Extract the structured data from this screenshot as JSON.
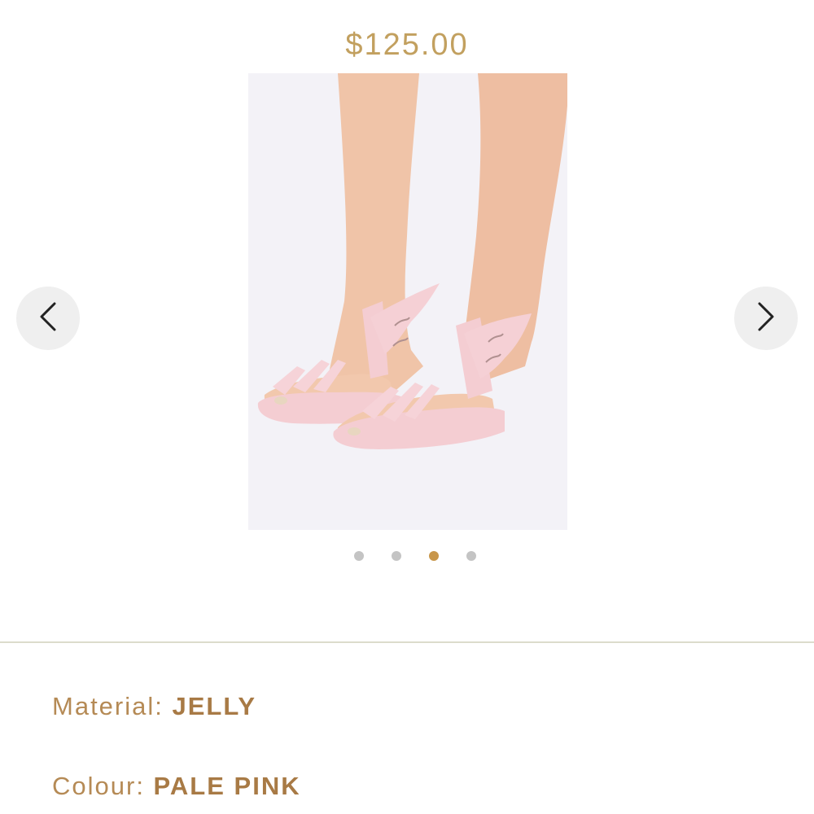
{
  "product": {
    "price": "$125.00"
  },
  "gallery": {
    "image_description_icon": "photo",
    "prev_icon": "chevron-left-icon",
    "next_icon": "chevron-right-icon",
    "total_images": 4,
    "active_index": 2
  },
  "attributes": {
    "material_label": "Material: ",
    "material_value": "JELLY",
    "colour_label": "Colour: ",
    "colour_value": "PALE PINK"
  },
  "colors": {
    "price": "#c2a05f",
    "accent": "#c8964a",
    "dot_inactive": "#c4c4c4",
    "sandal": "#f4cdd2",
    "skin": "#f0c6ab"
  }
}
